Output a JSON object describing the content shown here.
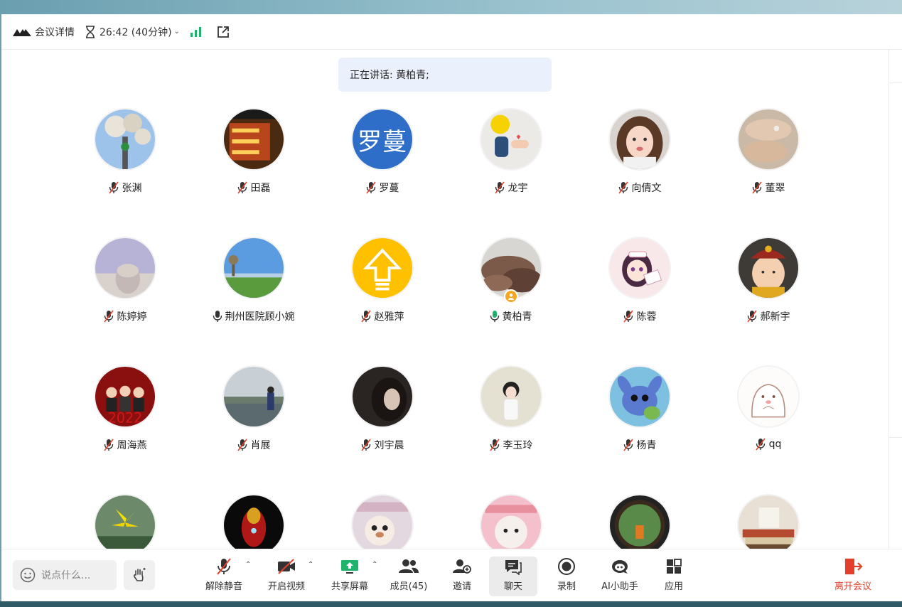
{
  "titlebar": {
    "meeting_details": "会议详情",
    "timer": "26:42 (40分钟)"
  },
  "speaker_banner": "正在讲话: 黄柏青;",
  "participants": [
    {
      "name": "张渊",
      "mic": "muted",
      "avatar": "photo-blossom"
    },
    {
      "name": "田磊",
      "mic": "muted",
      "avatar": "photo-red-sign"
    },
    {
      "name": "罗蔓",
      "mic": "muted",
      "avatar": "text",
      "avatar_text": "罗蔓"
    },
    {
      "name": "龙宇",
      "mic": "muted",
      "avatar": "photo-hands"
    },
    {
      "name": "向倩文",
      "mic": "muted",
      "avatar": "photo-girl"
    },
    {
      "name": "董翠",
      "mic": "muted",
      "avatar": "photo-hands-ring"
    },
    {
      "name": "陈婷婷",
      "mic": "muted",
      "avatar": "photo-beach"
    },
    {
      "name": "荆州医院顾小婉",
      "mic": "on",
      "avatar": "photo-field"
    },
    {
      "name": "赵雅萍",
      "mic": "muted",
      "avatar": "arrow-up"
    },
    {
      "name": "黄柏青",
      "mic": "speaking",
      "avatar": "photo-rocks",
      "host": true
    },
    {
      "name": "陈蓉",
      "mic": "muted",
      "avatar": "cartoon-nurse"
    },
    {
      "name": "郝新宇",
      "mic": "muted",
      "avatar": "cartoon-emperor"
    },
    {
      "name": "周海燕",
      "mic": "muted",
      "avatar": "photo-2022"
    },
    {
      "name": "肖展",
      "mic": "muted",
      "avatar": "photo-lake"
    },
    {
      "name": "刘宇晨",
      "mic": "muted",
      "avatar": "photo-dark-girl"
    },
    {
      "name": "李玉玲",
      "mic": "muted",
      "avatar": "photo-child"
    },
    {
      "name": "杨青",
      "mic": "muted",
      "avatar": "cartoon-stitch"
    },
    {
      "name": "qq",
      "mic": "muted",
      "avatar": "cartoon-seal"
    },
    {
      "name": "",
      "mic": "",
      "avatar": "photo-lily"
    },
    {
      "name": "",
      "mic": "",
      "avatar": "photo-ironman"
    },
    {
      "name": "",
      "mic": "",
      "avatar": "cartoon-bear"
    },
    {
      "name": "",
      "mic": "",
      "avatar": "cartoon-pink"
    },
    {
      "name": "",
      "mic": "",
      "avatar": "photo-window"
    },
    {
      "name": "",
      "mic": "",
      "avatar": "photo-books"
    }
  ],
  "toolbar": {
    "chat_placeholder": "说点什么...",
    "unmute": "解除静音",
    "start_video": "开启视频",
    "share_screen": "共享屏幕",
    "members": "成员(45)",
    "invite": "邀请",
    "chat": "聊天",
    "record": "录制",
    "ai_assistant": "AI小助手",
    "apps": "应用",
    "leave": "离开会议"
  },
  "colors": {
    "accent_blue": "#2f6ec8",
    "leave_red": "#e2402b",
    "signal_green": "#1fb36b",
    "host_badge": "#f5a623"
  }
}
